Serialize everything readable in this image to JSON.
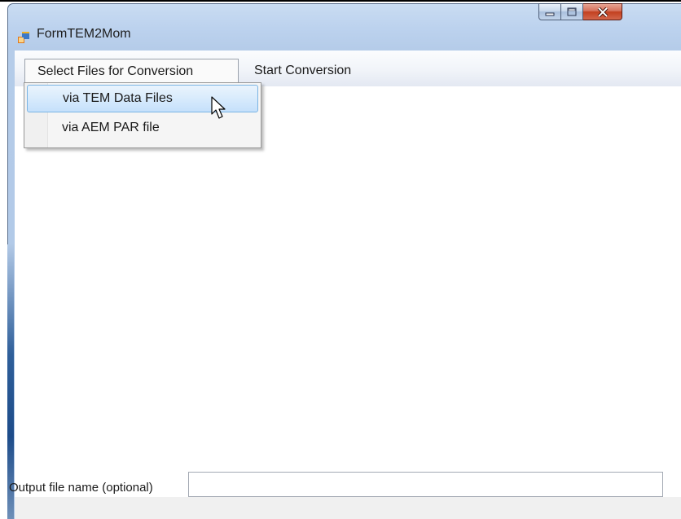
{
  "window": {
    "title": "FormTEM2Mom",
    "icon": "windows-form-icon",
    "controls": [
      "minimize-icon",
      "maximize-icon",
      "close-icon"
    ]
  },
  "menu": {
    "items": [
      {
        "label": "Select Files for Conversion",
        "open": true
      },
      {
        "label": "Start Conversion",
        "open": false
      }
    ],
    "dropdown": [
      {
        "label": "via TEM Data Files",
        "highlighted": true
      },
      {
        "label": "via AEM PAR file",
        "highlighted": false
      }
    ]
  },
  "output": {
    "label": "Output file name (optional)",
    "value": ""
  },
  "colors": {
    "highlight": "#c5e0fb",
    "close_button": "#c2401f"
  }
}
